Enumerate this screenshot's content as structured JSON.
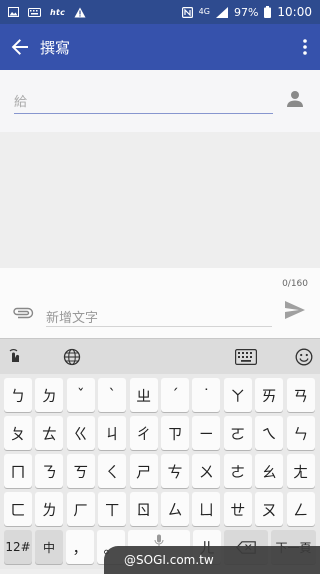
{
  "status_bar": {
    "carrier_logo": "htc",
    "network": "4G",
    "battery": "97%",
    "time": "10:00"
  },
  "app_bar": {
    "title": "撰寫"
  },
  "recipient": {
    "placeholder": "給"
  },
  "compose": {
    "char_counter": "0/160",
    "placeholder": "新增文字"
  },
  "keyboard": {
    "rows": [
      [
        "ㄅ",
        "ㄉ",
        "ˇ",
        "ˋ",
        "ㄓ",
        "ˊ",
        "˙",
        "ㄚ",
        "ㄞ",
        "ㄢ"
      ],
      [
        "ㄆ",
        "ㄊ",
        "ㄍ",
        "ㄐ",
        "ㄔ",
        "ㄗ",
        "ㄧ",
        "ㄛ",
        "ㄟ",
        "ㄣ"
      ],
      [
        "ㄇ",
        "ㄋ",
        "ㄎ",
        "ㄑ",
        "ㄕ",
        "ㄘ",
        "ㄨ",
        "ㄜ",
        "ㄠ",
        "ㄤ"
      ],
      [
        "ㄈ",
        "ㄌ",
        "ㄏ",
        "ㄒ",
        "ㄖ",
        "ㄙ",
        "ㄩ",
        "ㄝ",
        "ㄡ",
        "ㄥ"
      ]
    ],
    "bottom_row": {
      "symbols": "12#",
      "lang": "中",
      "comma": "，",
      "period": "。",
      "er": "ㄦ",
      "next": "下一頁"
    }
  },
  "watermark": "@SOGI.com.tw",
  "colors": {
    "status_bar": "#2e4b8f",
    "app_bar": "#3652ac",
    "accent_underline": "#8796cf"
  }
}
